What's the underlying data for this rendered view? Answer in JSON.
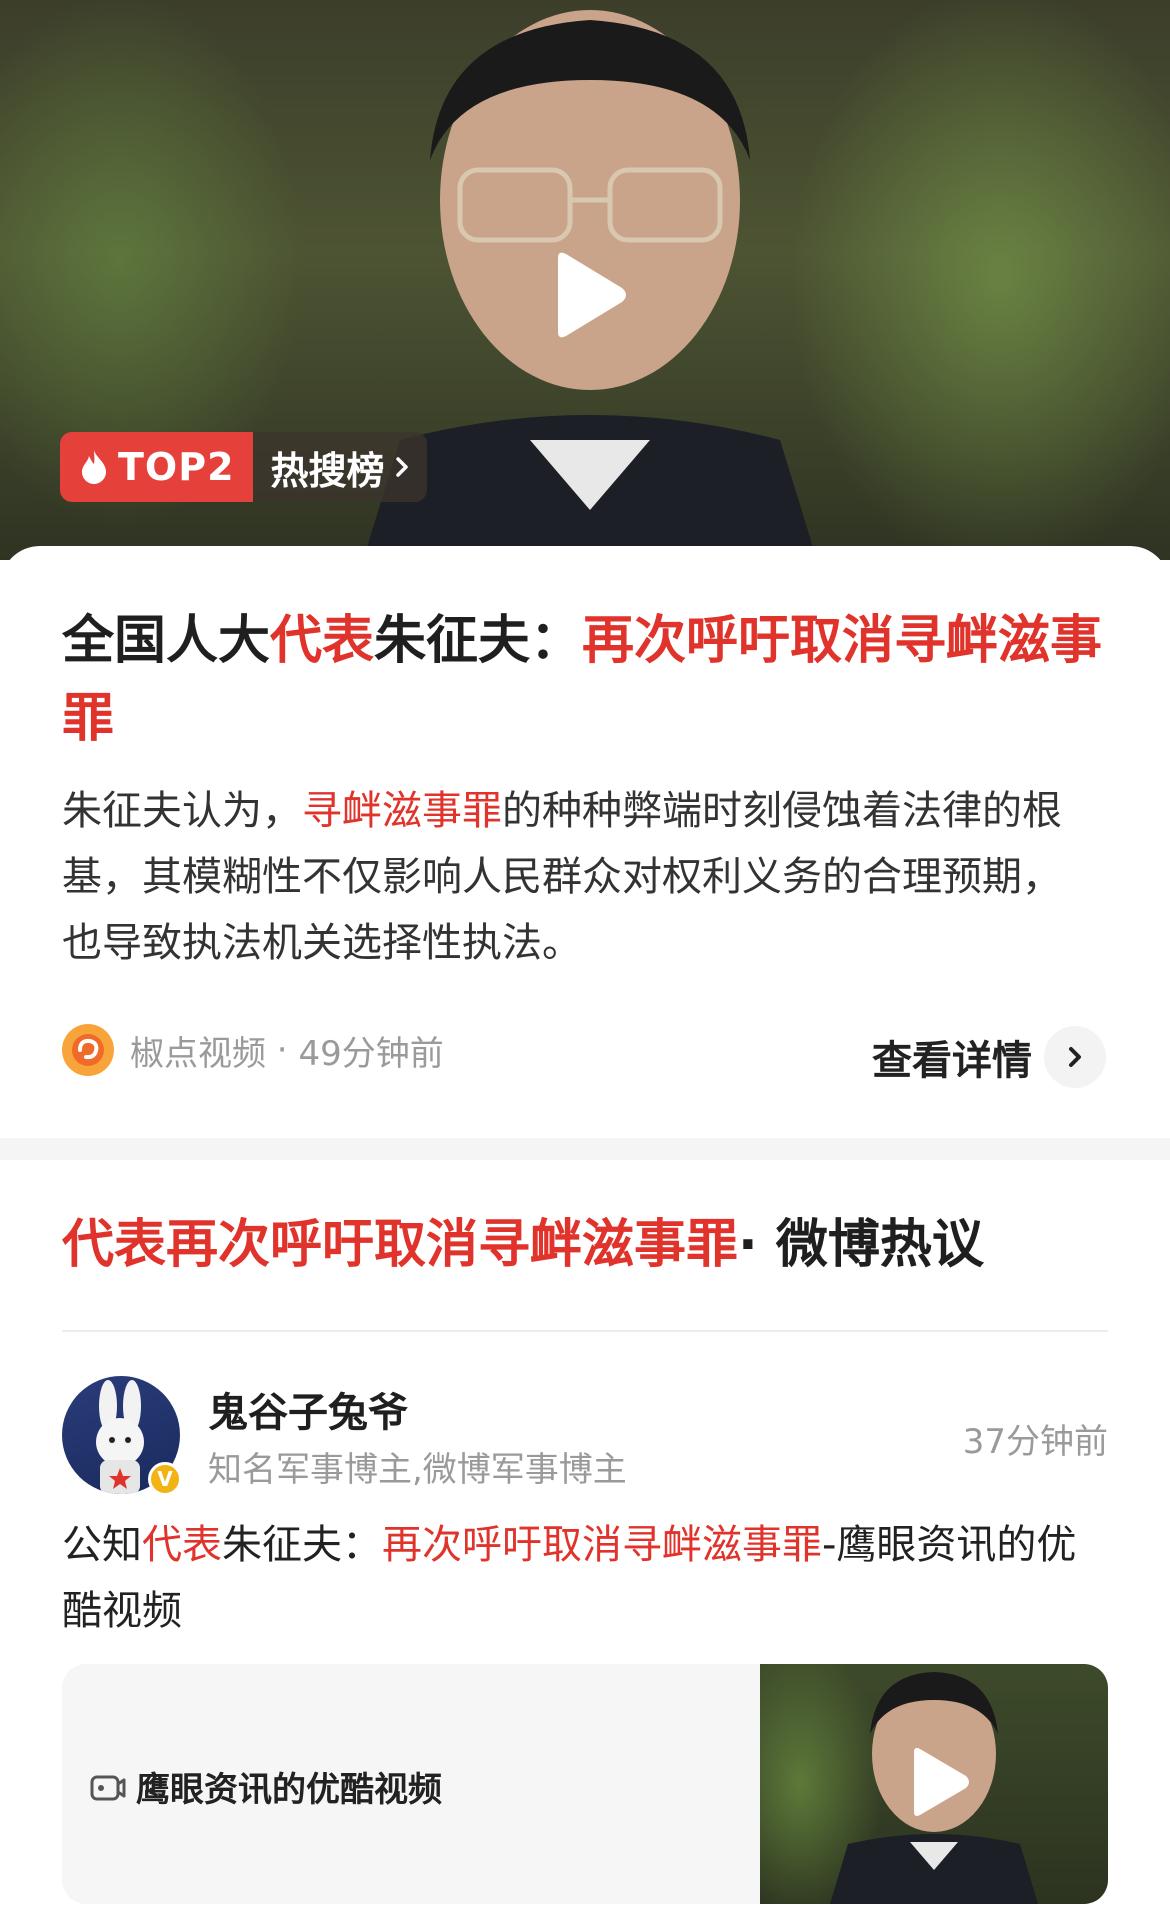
{
  "hero": {
    "badge_rank": "TOP2",
    "badge_list": "热搜榜"
  },
  "article": {
    "title_parts": [
      "全国人大",
      "代表",
      "朱征夫：",
      "再次呼吁取消寻衅滋事罪"
    ],
    "summary_parts": [
      "朱征夫认为，",
      "寻衅滋事罪",
      "的种种弊端时刻侵蚀着法律的根基，其模糊性不仅影响人民群众对权利义务的合理预期，也导致执法机关选择性执法。"
    ],
    "source": "椒点视频",
    "time": "49分钟前",
    "detail_label": "查看详情"
  },
  "weibo": {
    "title_topic": "代表再次呼吁取消寻衅滋事罪",
    "title_suffix": "· 微博热议",
    "post": {
      "username": "鬼谷子兔爷",
      "description": "知名军事博主,微博军事博主",
      "time": "37分钟前",
      "verified_mark": "V",
      "text_parts": [
        "公知",
        "代表",
        "朱征夫：",
        "再次呼吁取消寻衅滋事罪",
        "-鹰眼资讯的优酷视频"
      ],
      "video_label": "鹰眼资讯的优酷视频"
    }
  },
  "colors": {
    "accent_red": "#e0332b",
    "badge_red": "#e6403a"
  }
}
